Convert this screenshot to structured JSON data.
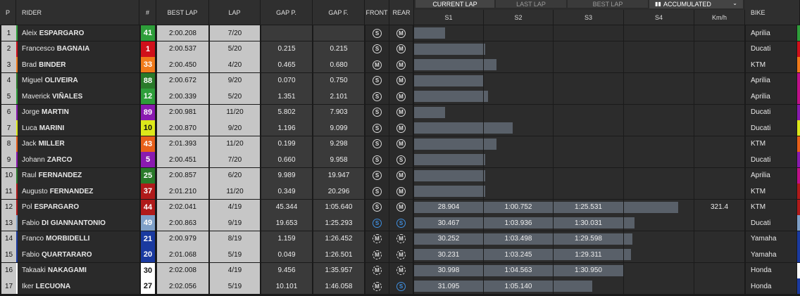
{
  "header": {
    "pos": "P",
    "rider": "RIDER",
    "num": "#",
    "best_lap": "BEST LAP",
    "lap": "LAP",
    "gap_p": "GAP P.",
    "gap_f": "GAP F.",
    "front": "FRONT",
    "rear": "REAR",
    "s1": "S1",
    "s2": "S2",
    "s3": "S3",
    "s4": "S4",
    "kmh": "Km/h",
    "bike": "BIKE"
  },
  "tabs": {
    "current_lap": "CURRENT LAP",
    "last_lap": "LAST LAP",
    "best_lap": "BEST LAP",
    "mode": "ACCUMULATED"
  },
  "rows": [
    {
      "pos": "1",
      "first": "Aleix",
      "last": "ESPARGARO",
      "num": "41",
      "num_bg": "#2e9e3a",
      "num_fg": "#ffffff",
      "best": "2:00.208",
      "lap": "7/20",
      "gap_p": "",
      "gap_f": "",
      "front": "S",
      "rear": "M",
      "front_style": "solid",
      "rear_style": "solid",
      "s1": "",
      "s2": "",
      "s3": "",
      "s4": "",
      "fill_s1": 0.45,
      "fill_s2": 0,
      "fill_s3": 0,
      "fill_s4": 0,
      "kmh": "",
      "bike": "Aprilia",
      "team_color": "#2e9e3a",
      "side_color": "#2e9e3a"
    },
    {
      "pos": "2",
      "first": "Francesco",
      "last": "BAGNAIA",
      "num": "1",
      "num_bg": "#d0101a",
      "num_fg": "#ffffff",
      "best": "2:00.537",
      "lap": "5/20",
      "gap_p": "0.215",
      "gap_f": "0.215",
      "front": "S",
      "rear": "M",
      "front_style": "solid",
      "rear_style": "solid",
      "s1": "",
      "s2": "",
      "s3": "",
      "s4": "",
      "fill_s1": 1,
      "fill_s2": 0.02,
      "fill_s3": 0,
      "fill_s4": 0,
      "kmh": "",
      "bike": "Ducati",
      "team_color": "#d0101a",
      "side_color": "#d0101a"
    },
    {
      "pos": "3",
      "first": "Brad",
      "last": "BINDER",
      "num": "33",
      "num_bg": "#f07a1a",
      "num_fg": "#ffffff",
      "best": "2:00.450",
      "lap": "4/20",
      "gap_p": "0.465",
      "gap_f": "0.680",
      "front": "M",
      "rear": "M",
      "front_style": "solid",
      "rear_style": "solid",
      "s1": "",
      "s2": "",
      "s3": "",
      "s4": "",
      "fill_s1": 1,
      "fill_s2": 0.18,
      "fill_s3": 0,
      "fill_s4": 0,
      "kmh": "",
      "bike": "KTM",
      "team_color": "#f07a1a",
      "side_color": "#f07a1a"
    },
    {
      "pos": "4",
      "first": "Miguel",
      "last": "OLIVEIRA",
      "num": "88",
      "num_bg": "#2a7a2a",
      "num_fg": "#ffffff",
      "best": "2:00.672",
      "lap": "9/20",
      "gap_p": "0.070",
      "gap_f": "0.750",
      "front": "S",
      "rear": "M",
      "front_style": "solid",
      "rear_style": "solid",
      "s1": "",
      "s2": "",
      "s3": "",
      "s4": "",
      "fill_s1": 1,
      "fill_s2": 0,
      "fill_s3": 0,
      "fill_s4": 0,
      "kmh": "",
      "bike": "Aprilia",
      "team_color": "#2a7a2a",
      "side_color": "#c0108a"
    },
    {
      "pos": "5",
      "first": "Maverick",
      "last": "VIÑALES",
      "num": "12",
      "num_bg": "#2e9e3a",
      "num_fg": "#ffffff",
      "best": "2:00.339",
      "lap": "5/20",
      "gap_p": "1.351",
      "gap_f": "2.101",
      "front": "S",
      "rear": "M",
      "front_style": "solid",
      "rear_style": "solid",
      "s1": "",
      "s2": "",
      "s3": "",
      "s4": "",
      "fill_s1": 1,
      "fill_s2": 0.06,
      "fill_s3": 0,
      "fill_s4": 0,
      "kmh": "",
      "bike": "Aprilia",
      "team_color": "#2e9e3a",
      "side_color": "#c0108a"
    },
    {
      "pos": "6",
      "first": "Jorge",
      "last": "MARTIN",
      "num": "89",
      "num_bg": "#8a1ab0",
      "num_fg": "#ffffff",
      "best": "2:00.981",
      "lap": "11/20",
      "gap_p": "5.802",
      "gap_f": "7.903",
      "front": "S",
      "rear": "M",
      "front_style": "solid",
      "rear_style": "solid",
      "s1": "",
      "s2": "",
      "s3": "",
      "s4": "",
      "fill_s1": 0.45,
      "fill_s2": 0,
      "fill_s3": 0,
      "fill_s4": 0,
      "kmh": "",
      "bike": "Ducati",
      "team_color": "#8a1ab0",
      "side_color": "#8a1ab0"
    },
    {
      "pos": "7",
      "first": "Luca",
      "last": "MARINI",
      "num": "10",
      "num_bg": "#dde81a",
      "num_fg": "#111111",
      "best": "2:00.870",
      "lap": "9/20",
      "gap_p": "1.196",
      "gap_f": "9.099",
      "front": "S",
      "rear": "M",
      "front_style": "solid",
      "rear_style": "solid",
      "s1": "",
      "s2": "",
      "s3": "",
      "s4": "",
      "fill_s1": 1,
      "fill_s2": 0.42,
      "fill_s3": 0,
      "fill_s4": 0,
      "kmh": "",
      "bike": "Ducati",
      "team_color": "#dde81a",
      "side_color": "#dde81a"
    },
    {
      "pos": "8",
      "first": "Jack",
      "last": "MILLER",
      "num": "43",
      "num_bg": "#e8601a",
      "num_fg": "#ffffff",
      "best": "2:01.393",
      "lap": "11/20",
      "gap_p": "0.199",
      "gap_f": "9.298",
      "front": "S",
      "rear": "M",
      "front_style": "solid",
      "rear_style": "solid",
      "s1": "",
      "s2": "",
      "s3": "",
      "s4": "",
      "fill_s1": 1,
      "fill_s2": 0.18,
      "fill_s3": 0,
      "fill_s4": 0,
      "kmh": "",
      "bike": "KTM",
      "team_color": "#e8601a",
      "side_color": "#e8601a"
    },
    {
      "pos": "9",
      "first": "Johann",
      "last": "ZARCO",
      "num": "5",
      "num_bg": "#8a1ab0",
      "num_fg": "#ffffff",
      "best": "2:00.451",
      "lap": "7/20",
      "gap_p": "0.660",
      "gap_f": "9.958",
      "front": "S",
      "rear": "S",
      "front_style": "solid",
      "rear_style": "solid",
      "s1": "",
      "s2": "",
      "s3": "",
      "s4": "",
      "fill_s1": 1,
      "fill_s2": 0.02,
      "fill_s3": 0,
      "fill_s4": 0,
      "kmh": "",
      "bike": "Ducati",
      "team_color": "#8a1ab0",
      "side_color": "#8a1ab0"
    },
    {
      "pos": "10",
      "first": "Raul",
      "last": "FERNANDEZ",
      "num": "25",
      "num_bg": "#2a7a2a",
      "num_fg": "#ffffff",
      "best": "2:00.857",
      "lap": "6/20",
      "gap_p": "9.989",
      "gap_f": "19.947",
      "front": "S",
      "rear": "M",
      "front_style": "solid",
      "rear_style": "solid",
      "s1": "",
      "s2": "",
      "s3": "",
      "s4": "",
      "fill_s1": 1,
      "fill_s2": 0.02,
      "fill_s3": 0,
      "fill_s4": 0,
      "kmh": "",
      "bike": "Aprilia",
      "team_color": "#2a7a2a",
      "side_color": "#c0108a"
    },
    {
      "pos": "11",
      "first": "Augusto",
      "last": "FERNANDEZ",
      "num": "37",
      "num_bg": "#b01a1a",
      "num_fg": "#ffffff",
      "best": "2:01.210",
      "lap": "11/20",
      "gap_p": "0.349",
      "gap_f": "20.296",
      "front": "S",
      "rear": "M",
      "front_style": "solid",
      "rear_style": "solid",
      "s1": "",
      "s2": "",
      "s3": "",
      "s4": "",
      "fill_s1": 1,
      "fill_s2": 0.02,
      "fill_s3": 0,
      "fill_s4": 0,
      "kmh": "",
      "bike": "KTM",
      "team_color": "#b01a1a",
      "side_color": "#b01a1a"
    },
    {
      "pos": "12",
      "first": "Pol",
      "last": "ESPARGARO",
      "num": "44",
      "num_bg": "#b01a1a",
      "num_fg": "#ffffff",
      "best": "2:02.041",
      "lap": "4/19",
      "gap_p": "45.344",
      "gap_f": "1:05.640",
      "front": "S",
      "rear": "M",
      "front_style": "solid",
      "rear_style": "solid",
      "s1": "28.904",
      "s2": "1:00.752",
      "s3": "1:25.531",
      "s4": "",
      "fill_s1": 1,
      "fill_s2": 1,
      "fill_s3": 1,
      "fill_s4": 0.78,
      "kmh": "321.4",
      "bike": "KTM",
      "team_color": "#b01a1a",
      "side_color": "#b01a1a"
    },
    {
      "pos": "13",
      "first": "Fabio",
      "last": "DI GIANNANTONIO",
      "num": "49",
      "num_bg": "#7fa0c8",
      "num_fg": "#ffffff",
      "best": "2:00.863",
      "lap": "9/19",
      "gap_p": "19.653",
      "gap_f": "1:25.293",
      "front": "S",
      "rear": "S",
      "front_style": "blue",
      "rear_style": "blue",
      "s1": "30.467",
      "s2": "1:03.936",
      "s3": "1:30.031",
      "s4": "",
      "fill_s1": 1,
      "fill_s2": 1,
      "fill_s3": 1,
      "fill_s4": 0.15,
      "kmh": "",
      "bike": "Ducati",
      "team_color": "#7fa0c8",
      "side_color": "#7fa0c8"
    },
    {
      "pos": "14",
      "first": "Franco",
      "last": "MORBIDELLI",
      "num": "21",
      "num_bg": "#1a3aa0",
      "num_fg": "#ffffff",
      "best": "2:00.979",
      "lap": "8/19",
      "gap_p": "1.159",
      "gap_f": "1:26.452",
      "front": "M",
      "rear": "M",
      "front_style": "dash",
      "rear_style": "dash",
      "s1": "30.252",
      "s2": "1:03.498",
      "s3": "1:29.598",
      "s4": "",
      "fill_s1": 1,
      "fill_s2": 1,
      "fill_s3": 1,
      "fill_s4": 0.12,
      "kmh": "",
      "bike": "Yamaha",
      "team_color": "#1a3aa0",
      "side_color": "#1a3aa0"
    },
    {
      "pos": "15",
      "first": "Fabio",
      "last": "QUARTARARO",
      "num": "20",
      "num_bg": "#1a3aa0",
      "num_fg": "#ffffff",
      "best": "2:01.068",
      "lap": "5/19",
      "gap_p": "0.049",
      "gap_f": "1:26.501",
      "front": "M",
      "rear": "M",
      "front_style": "dash",
      "rear_style": "dash",
      "s1": "30.231",
      "s2": "1:03.245",
      "s3": "1:29.311",
      "s4": "",
      "fill_s1": 1,
      "fill_s2": 1,
      "fill_s3": 1,
      "fill_s4": 0.1,
      "kmh": "",
      "bike": "Yamaha",
      "team_color": "#1a3aa0",
      "side_color": "#1a3aa0"
    },
    {
      "pos": "16",
      "first": "Takaaki",
      "last": "NAKAGAMI",
      "num": "30",
      "num_bg": "#ffffff",
      "num_fg": "#111111",
      "best": "2:02.008",
      "lap": "4/19",
      "gap_p": "9.456",
      "gap_f": "1:35.957",
      "front": "M",
      "rear": "M",
      "front_style": "dash",
      "rear_style": "dash",
      "s1": "30.998",
      "s2": "1:04.563",
      "s3": "1:30.950",
      "s4": "",
      "fill_s1": 1,
      "fill_s2": 1,
      "fill_s3": 1,
      "fill_s4": 0,
      "kmh": "",
      "bike": "Honda",
      "team_color": "#ffffff",
      "side_color": "#ffffff"
    },
    {
      "pos": "17",
      "first": "Iker",
      "last": "LECUONA",
      "num": "27",
      "num_bg": "#ffffff",
      "num_fg": "#111111",
      "best": "2:02.056",
      "lap": "5/19",
      "gap_p": "10.101",
      "gap_f": "1:46.058",
      "front": "M",
      "rear": "S",
      "front_style": "dash",
      "rear_style": "blue",
      "s1": "31.095",
      "s2": "1:05.140",
      "s3": "",
      "s4": "",
      "fill_s1": 1,
      "fill_s2": 1,
      "fill_s3": 0.56,
      "fill_s4": 0,
      "kmh": "",
      "bike": "Honda",
      "team_color": "#ffffff",
      "side_color": "#1a3aa0"
    }
  ]
}
